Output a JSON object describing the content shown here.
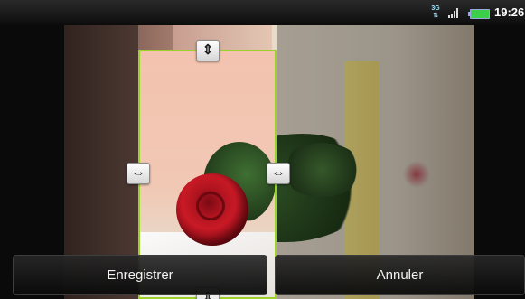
{
  "status_bar": {
    "network_label": "3G",
    "time": "19:26",
    "icons": [
      "network-3g-icon",
      "signal-icon",
      "battery-icon"
    ]
  },
  "crop": {
    "handle_icons": [
      "arrow-up-down-icon",
      "arrow-left-right-icon",
      "arrow-left-right-icon",
      "arrow-up-down-icon"
    ],
    "frame_color": "#9cd02a"
  },
  "actions": {
    "save_label": "Enregistrer",
    "cancel_label": "Annuler"
  }
}
